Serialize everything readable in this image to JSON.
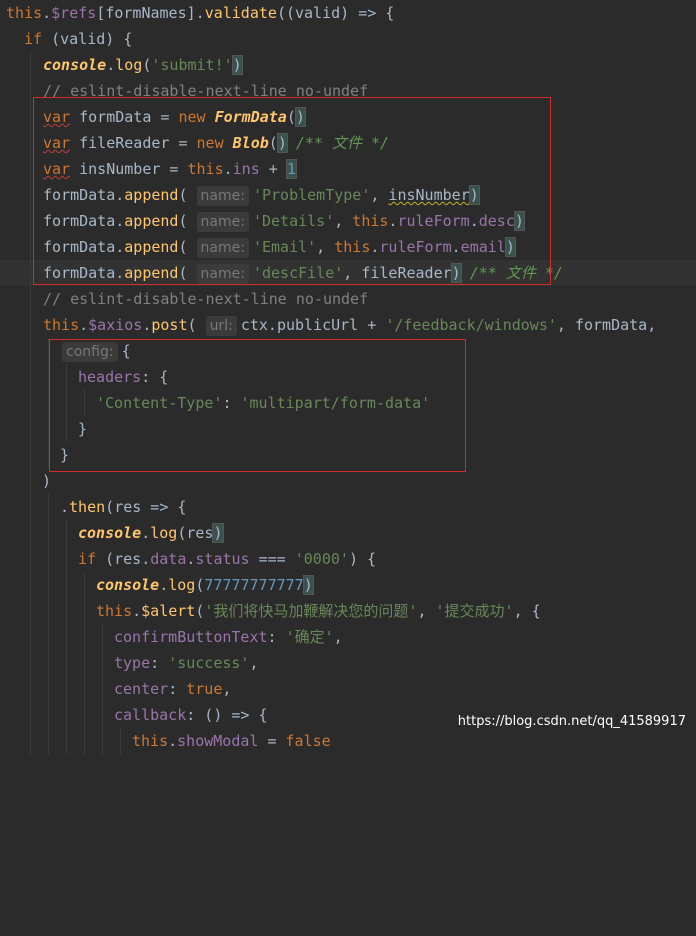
{
  "colors": {
    "background": "#2b2b2b",
    "keyword": "#cc7832",
    "string": "#6a8759",
    "number": "#6897bb",
    "property": "#9876aa",
    "function": "#ffc66d",
    "comment": "#808080",
    "highlight_box": "#d12b2b"
  },
  "hints": {
    "name": "name:",
    "url": "url:",
    "config": "config:"
  },
  "code": {
    "validate_call": "validate",
    "valid": "valid",
    "form_names": "formNames",
    "submit_str": "'submit!'",
    "eslint_comment": "// eslint-disable-next-line no-undef",
    "form_data_var": "formData",
    "form_data_class": "FormData",
    "file_reader_var": "fileReader",
    "blob_class": "Blob",
    "doc_comment": "/** 文件 */",
    "ins_number_var": "insNumber",
    "ins_prop": "ins",
    "one": "1",
    "append": "append",
    "problem_type_str": "'ProblemType'",
    "details_str": "'Details'",
    "email_str": "'Email'",
    "desc_file_str": "'descFile'",
    "rule_form": "ruleForm",
    "desc": "desc",
    "email": "email",
    "axios": "$axios",
    "post": "post",
    "ctx": "ctx",
    "public_url": "publicUrl",
    "feedback_str": "'/feedback/windows'",
    "headers": "headers",
    "content_type_str": "'Content-Type'",
    "multipart_str": "'multipart/form-data'",
    "then": "then",
    "res": "res",
    "console": "console",
    "log": "log",
    "data": "data",
    "status": "status",
    "zero_str": "'0000'",
    "big_number": "77777777777",
    "alert": "$alert",
    "alert_msg_str": "'我们将快马加鞭解决您的问题'",
    "alert_title_str": "'提交成功'",
    "confirm_button_text": "confirmButtonText",
    "confirm_str": "'确定'",
    "type": "type",
    "success_str": "'success'",
    "center": "center",
    "true_kw": "true",
    "callback": "callback",
    "show_modal": "showModal",
    "false_kw": "false"
  },
  "watermark": "https://blog.csdn.net/qq_41589917"
}
